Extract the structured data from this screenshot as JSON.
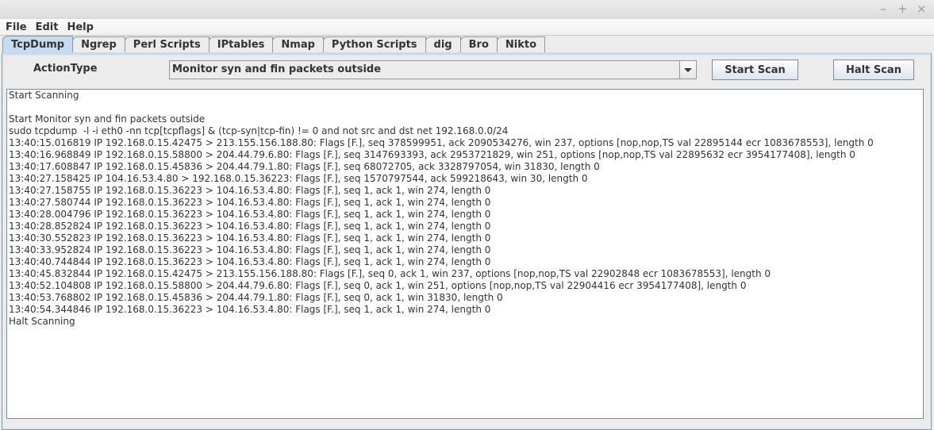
{
  "window": {
    "controls": [
      {
        "name": "minimize-button",
        "glyph": "–"
      },
      {
        "name": "maximize-button",
        "glyph": "+"
      },
      {
        "name": "close-button",
        "glyph": "×"
      }
    ]
  },
  "menubar": {
    "items": [
      "File",
      "Edit",
      "Help"
    ]
  },
  "tabs": {
    "active": "TcpDump",
    "items": [
      "TcpDump",
      "Ngrep",
      "Perl Scripts",
      "IPtables",
      "Nmap",
      "Python Scripts",
      "dig",
      "Bro",
      "Nikto"
    ]
  },
  "toolbar": {
    "action_label": "ActionType",
    "action_selected": "Monitor syn and fin packets outside",
    "start_label": "Start Scan",
    "halt_label": "Halt Scan"
  },
  "output": {
    "lines": [
      "Start Scanning",
      "",
      "Start Monitor syn and fin packets outside",
      "sudo tcpdump  -l -i eth0 -nn tcp[tcpflags] & (tcp-syn|tcp-fin) != 0 and not src and dst net 192.168.0.0/24",
      "13:40:15.016819 IP 192.168.0.15.42475 > 213.155.156.188.80: Flags [F.], seq 378599951, ack 2090534276, win 237, options [nop,nop,TS val 22895144 ecr 1083678553], length 0",
      "13:40:16.968849 IP 192.168.0.15.58800 > 204.44.79.6.80: Flags [F.], seq 3147693393, ack 2953721829, win 251, options [nop,nop,TS val 22895632 ecr 3954177408], length 0",
      "13:40:17.608847 IP 192.168.0.15.45836 > 204.44.79.1.80: Flags [F.], seq 68072705, ack 3328797054, win 31830, length 0",
      "13:40:27.158425 IP 104.16.53.4.80 > 192.168.0.15.36223: Flags [F.], seq 1570797544, ack 599218643, win 30, length 0",
      "13:40:27.158755 IP 192.168.0.15.36223 > 104.16.53.4.80: Flags [F.], seq 1, ack 1, win 274, length 0",
      "13:40:27.580744 IP 192.168.0.15.36223 > 104.16.53.4.80: Flags [F.], seq 1, ack 1, win 274, length 0",
      "13:40:28.004796 IP 192.168.0.15.36223 > 104.16.53.4.80: Flags [F.], seq 1, ack 1, win 274, length 0",
      "13:40:28.852824 IP 192.168.0.15.36223 > 104.16.53.4.80: Flags [F.], seq 1, ack 1, win 274, length 0",
      "13:40:30.552823 IP 192.168.0.15.36223 > 104.16.53.4.80: Flags [F.], seq 1, ack 1, win 274, length 0",
      "13:40:33.952824 IP 192.168.0.15.36223 > 104.16.53.4.80: Flags [F.], seq 1, ack 1, win 274, length 0",
      "13:40:40.744844 IP 192.168.0.15.36223 > 104.16.53.4.80: Flags [F.], seq 1, ack 1, win 274, length 0",
      "13:40:45.832844 IP 192.168.0.15.42475 > 213.155.156.188.80: Flags [F.], seq 0, ack 1, win 237, options [nop,nop,TS val 22902848 ecr 1083678553], length 0",
      "13:40:52.104808 IP 192.168.0.15.58800 > 204.44.79.6.80: Flags [F.], seq 0, ack 1, win 251, options [nop,nop,TS val 22904416 ecr 3954177408], length 0",
      "13:40:53.768802 IP 192.168.0.15.45836 > 204.44.79.1.80: Flags [F.], seq 0, ack 1, win 31830, length 0",
      "13:40:54.344846 IP 192.168.0.15.36223 > 104.16.53.4.80: Flags [F.], seq 1, ack 1, win 274, length 0",
      "Halt Scanning"
    ]
  }
}
